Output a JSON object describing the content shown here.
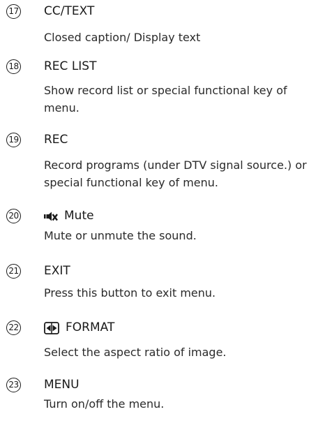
{
  "items": [
    {
      "number": "17",
      "title": "CC/TEXT",
      "description": "Closed caption/ Display text"
    },
    {
      "number": "18",
      "title": "REC LIST",
      "description": "Show record list or special functional key of menu."
    },
    {
      "number": "19",
      "title": "REC",
      "description": "Record programs (under DTV signal source.) or special functional key of menu."
    },
    {
      "number": "20",
      "title": "Mute",
      "icon": "mute-icon",
      "description": "Mute or unmute the sound."
    },
    {
      "number": "21",
      "title": "EXIT",
      "description": "Press this button to exit menu."
    },
    {
      "number": "22",
      "title": "FORMAT",
      "icon": "format-icon",
      "description": "Select the aspect ratio of image."
    },
    {
      "number": "23",
      "title": "MENU",
      "description": "Turn on/off the menu."
    }
  ]
}
